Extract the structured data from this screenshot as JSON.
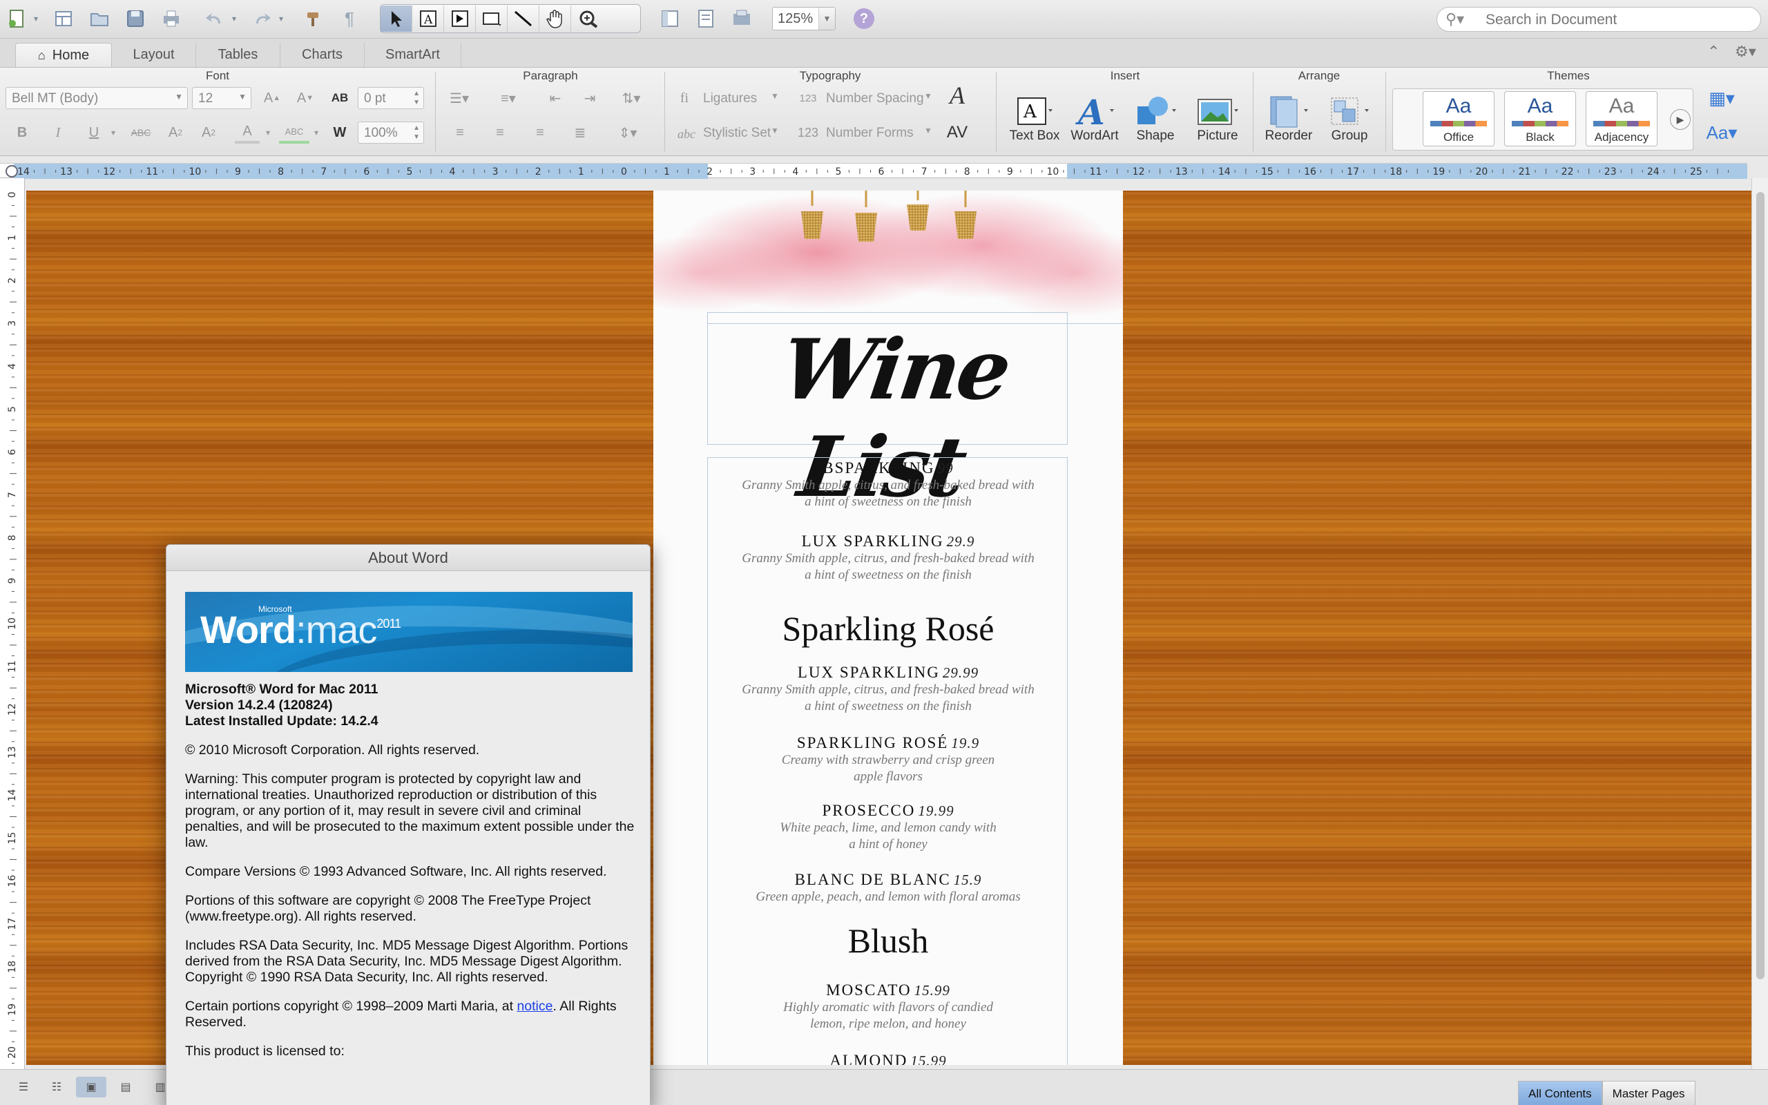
{
  "toolbar": {
    "zoom": "125%",
    "search_placeholder": "Search in Document"
  },
  "tabs": [
    "Home",
    "Layout",
    "Tables",
    "Charts",
    "SmartArt"
  ],
  "ribbon": {
    "font_group": "Font",
    "font_name": "Bell MT (Body)",
    "font_size": "12",
    "char_spacing": "0 pt",
    "scale": "100%",
    "paragraph_group": "Paragraph",
    "typography_group": "Typography",
    "ligatures": "Ligatures",
    "number_spacing": "Number Spacing",
    "stylistic_set": "Stylistic Set",
    "number_forms": "Number Forms",
    "insert_group": "Insert",
    "text_box": "Text Box",
    "wordart": "WordArt",
    "shape": "Shape",
    "picture": "Picture",
    "arrange_group": "Arrange",
    "reorder": "Reorder",
    "group": "Group",
    "themes_group": "Themes",
    "themes": [
      "Office",
      "Black",
      "Adjacency"
    ]
  },
  "ruler": {
    "h_ticks": [
      "14",
      "13",
      "12",
      "11",
      "10",
      "9",
      "8",
      "7",
      "6",
      "5",
      "4",
      "3",
      "2",
      "1",
      "0",
      "1",
      "2",
      "3",
      "4",
      "5",
      "6",
      "7",
      "8",
      "9",
      "10",
      "11",
      "12",
      "13",
      "14",
      "15",
      "16",
      "17",
      "18",
      "19",
      "20",
      "21",
      "22",
      "23",
      "24",
      "25"
    ],
    "v_ticks": [
      "0",
      "1",
      "2",
      "3",
      "4",
      "5",
      "6",
      "7",
      "8",
      "9",
      "10",
      "11",
      "12",
      "13",
      "14",
      "15",
      "16",
      "17",
      "18",
      "19",
      "20"
    ]
  },
  "document": {
    "title": "Wine List",
    "items": [
      {
        "name": "BSPARKLING",
        "price": "99",
        "desc1": "Granny Smith apple, citrus, and fresh-baked bread with",
        "desc2": "a hint of sweetness on the finish"
      },
      {
        "name": "LUX SPARKLING",
        "price": "29.9",
        "desc1": "Granny Smith apple, citrus, and fresh-baked bread with",
        "desc2": "a hint of sweetness on the finish"
      },
      {
        "name": "LUX SPARKLING",
        "price": "29.99",
        "desc1": "Granny Smith apple, citrus, and fresh-baked bread with",
        "desc2": "a hint of sweetness on the finish"
      },
      {
        "name": "SPARKLING ROSÉ",
        "price": "19.9",
        "desc1": "Creamy with strawberry and crisp green",
        "desc2": "apple flavors"
      },
      {
        "name": "PROSECCO",
        "price": "19.99",
        "desc1": "White peach, lime, and lemon candy with",
        "desc2": "a hint of honey"
      },
      {
        "name": "BLANC DE BLANC",
        "price": "15.9",
        "desc1": "Green apple, peach, and lemon with floral aromas",
        "desc2": ""
      },
      {
        "name": "MOSCATO",
        "price": "15.99",
        "desc1": "Highly aromatic with flavors of candied",
        "desc2": "lemon, ripe melon, and honey"
      },
      {
        "name": "ALMOND",
        "price": "15.99",
        "desc1": "",
        "desc2": ""
      }
    ],
    "section_rose": "Sparkling Rosé",
    "section_blush": "Blush"
  },
  "dialog": {
    "title": "About Word",
    "banner": {
      "ms": "Microsoft",
      "word": "Word",
      "mac": ":mac",
      "year": "2011"
    },
    "product": "Microsoft® Word for Mac 2011",
    "version": "Version 14.2.4 (120824)",
    "update": "Latest Installed Update: 14.2.4",
    "copyright": "© 2010 Microsoft Corporation. All rights reserved.",
    "warning": "Warning: This computer program is protected by copyright law and international treaties.  Unauthorized reproduction or distribution of this program, or any portion of it, may result in severe civil and criminal penalties, and will be prosecuted to the maximum extent possible under the law.",
    "compare": "Compare Versions © 1993 Advanced Software, Inc.  All rights reserved.",
    "freetype": "Portions of this software are copyright © 2008 The FreeType Project (www.freetype.org).  All rights reserved.",
    "rsa": "Includes RSA Data Security, Inc. MD5 Message Digest Algorithm. Portions derived from the RSA Data Security, Inc. MD5 Message Digest Algorithm.  Copyright © 1990 RSA Data Security, Inc. All rights reserved.",
    "marti_pre": "Certain portions copyright © 1998–2009  Marti Maria, at ",
    "marti_link": "notice",
    "marti_post": ".  All Rights Reserved.",
    "licensed": "This product is licensed to:"
  },
  "status": {
    "all_contents": "All Contents",
    "master_pages": "Master Pages"
  },
  "colors": {
    "canvas_wood": "#b8651a",
    "ribbon_bg": "#e8e8e8",
    "active_pager": "#8fb3e3",
    "link": "#1a3ee8"
  }
}
